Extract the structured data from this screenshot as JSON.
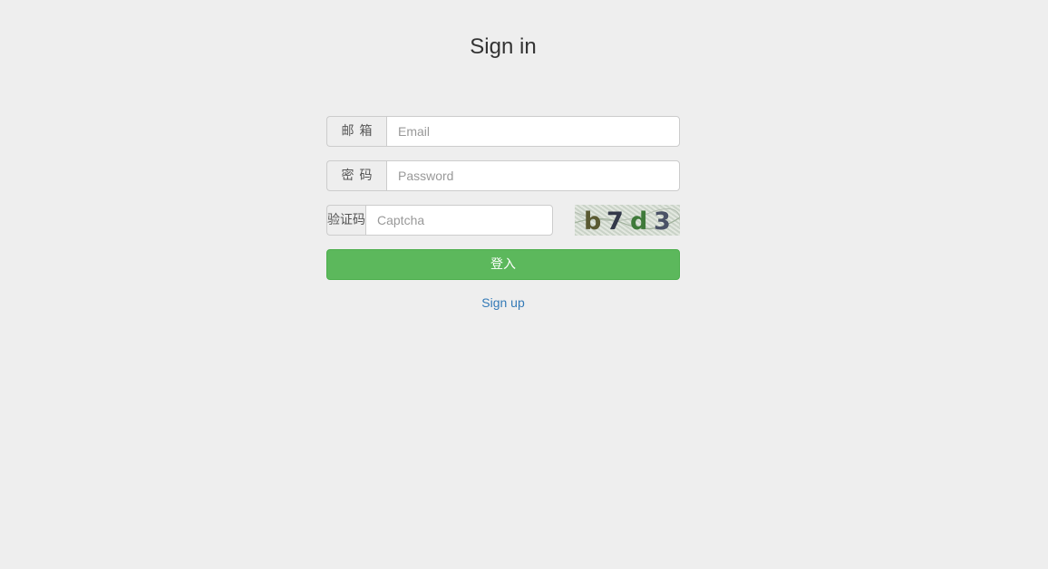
{
  "page": {
    "title": "Sign in"
  },
  "form": {
    "email": {
      "label": "邮箱",
      "value": "",
      "placeholder": "Email"
    },
    "password": {
      "label": "密码",
      "value": "",
      "placeholder": "Password"
    },
    "captcha": {
      "label": "验证码",
      "value": "",
      "placeholder": "Captcha",
      "image_text": "b7d3"
    },
    "submit_label": "登入",
    "signup_link": "Sign up"
  },
  "colors": {
    "background": "#eeeeee",
    "primary_button": "#5cb85c",
    "link": "#337ab7"
  }
}
